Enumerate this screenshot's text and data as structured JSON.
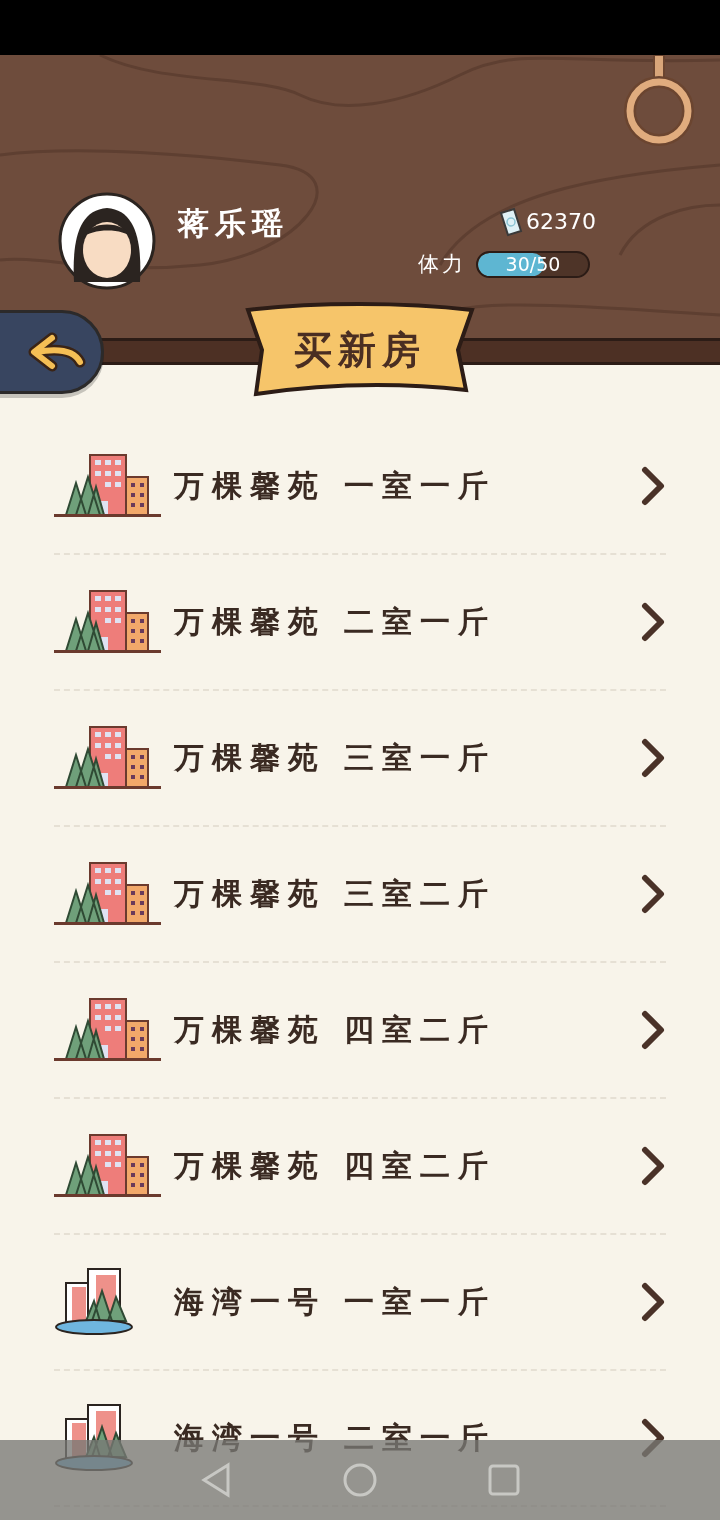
{
  "player": {
    "name": "蒋乐瑶",
    "money": "62370",
    "stamina_label": "体力",
    "stamina": {
      "reading": "30/50",
      "level": 0.6
    }
  },
  "title": "买新房",
  "houses": [
    {
      "kind": "garden",
      "estate": "万棵馨苑",
      "layout": "一室一斤"
    },
    {
      "kind": "garden",
      "estate": "万棵馨苑",
      "layout": "二室一斤"
    },
    {
      "kind": "garden",
      "estate": "万棵馨苑",
      "layout": "三室一斤"
    },
    {
      "kind": "garden",
      "estate": "万棵馨苑",
      "layout": "三室二斤"
    },
    {
      "kind": "garden",
      "estate": "万棵馨苑",
      "layout": "四室二斤"
    },
    {
      "kind": "garden",
      "estate": "万棵馨苑",
      "layout": "四室二斤"
    },
    {
      "kind": "bay",
      "estate": "海湾一号",
      "layout": "一室一斤"
    },
    {
      "kind": "bay",
      "estate": "海湾一号",
      "layout": "二室一斤"
    }
  ]
}
